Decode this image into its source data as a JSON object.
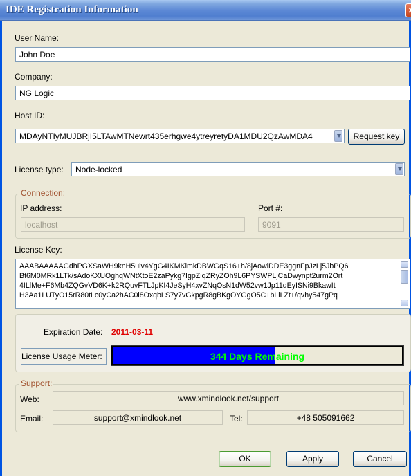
{
  "window": {
    "title": "IDE Registration Information"
  },
  "user": {
    "label": "User Name:",
    "value": "John Doe"
  },
  "company": {
    "label": "Company:",
    "value": "NG Logic"
  },
  "host": {
    "label": "Host ID:",
    "value": "MDAyNTIyMUJBRjI5LTAwMTNewrt435erhgwe4ytreyretyDA1MDU2QzAwMDA4",
    "request_label": "Request key"
  },
  "license_type": {
    "label": "License type:",
    "value": "Node-locked"
  },
  "connection": {
    "title": "Connection:",
    "ip_label": "IP address:",
    "ip_value": "localhost",
    "port_label": "Port #:",
    "port_value": "9091"
  },
  "license_key": {
    "label": "License Key:",
    "lines": [
      "AAABAAAAAGdhPGXSaWH9knH5ulv4YgG4IKMKlmkDBWGqS16+h/8jAowlDDE3ggnFpJzLj5JbPQ6",
      "Bt6M0MRk1LTk/sAdoKXUOghqWNtXtoE2zaPykg7IgpZiqZRyZOh9L6PYSWPLjCaDwynpt2urm2Ort",
      "4ILlMe+F6Mb4ZQGvVD6K+k2RQuvFTLJpKI4JeSyH4xvZNqOsN1dW52vw1Jp11dEyISNi9BkawIt",
      "H3Aa1LUTyO15rR80tLc0yCa2hAC0l8OxqbLS7y7vGkpgR8gBKgOYGgO5C+bLiLZt+/qvhy547gPq"
    ]
  },
  "expiration": {
    "label": "Expiration Date:",
    "value": "2011-03-11",
    "color": "#e00000"
  },
  "meter": {
    "label": "License Usage Meter:",
    "text": "344 Days Remaining",
    "fraction": 0.56,
    "fill_color": "#0000ff",
    "text_color": "#00ff00"
  },
  "support": {
    "title": "Support:",
    "web_label": "Web:",
    "web_value": "www.xmindlook.net/support",
    "email_label": "Email:",
    "email_value": "support@xmindlook.net",
    "tel_label": "Tel:",
    "tel_value": "+48 505091662"
  },
  "buttons": {
    "ok": "OK",
    "apply": "Apply",
    "cancel": "Cancel"
  },
  "icons": {
    "close": "close-icon",
    "dropdown": "chevron-down-icon"
  }
}
